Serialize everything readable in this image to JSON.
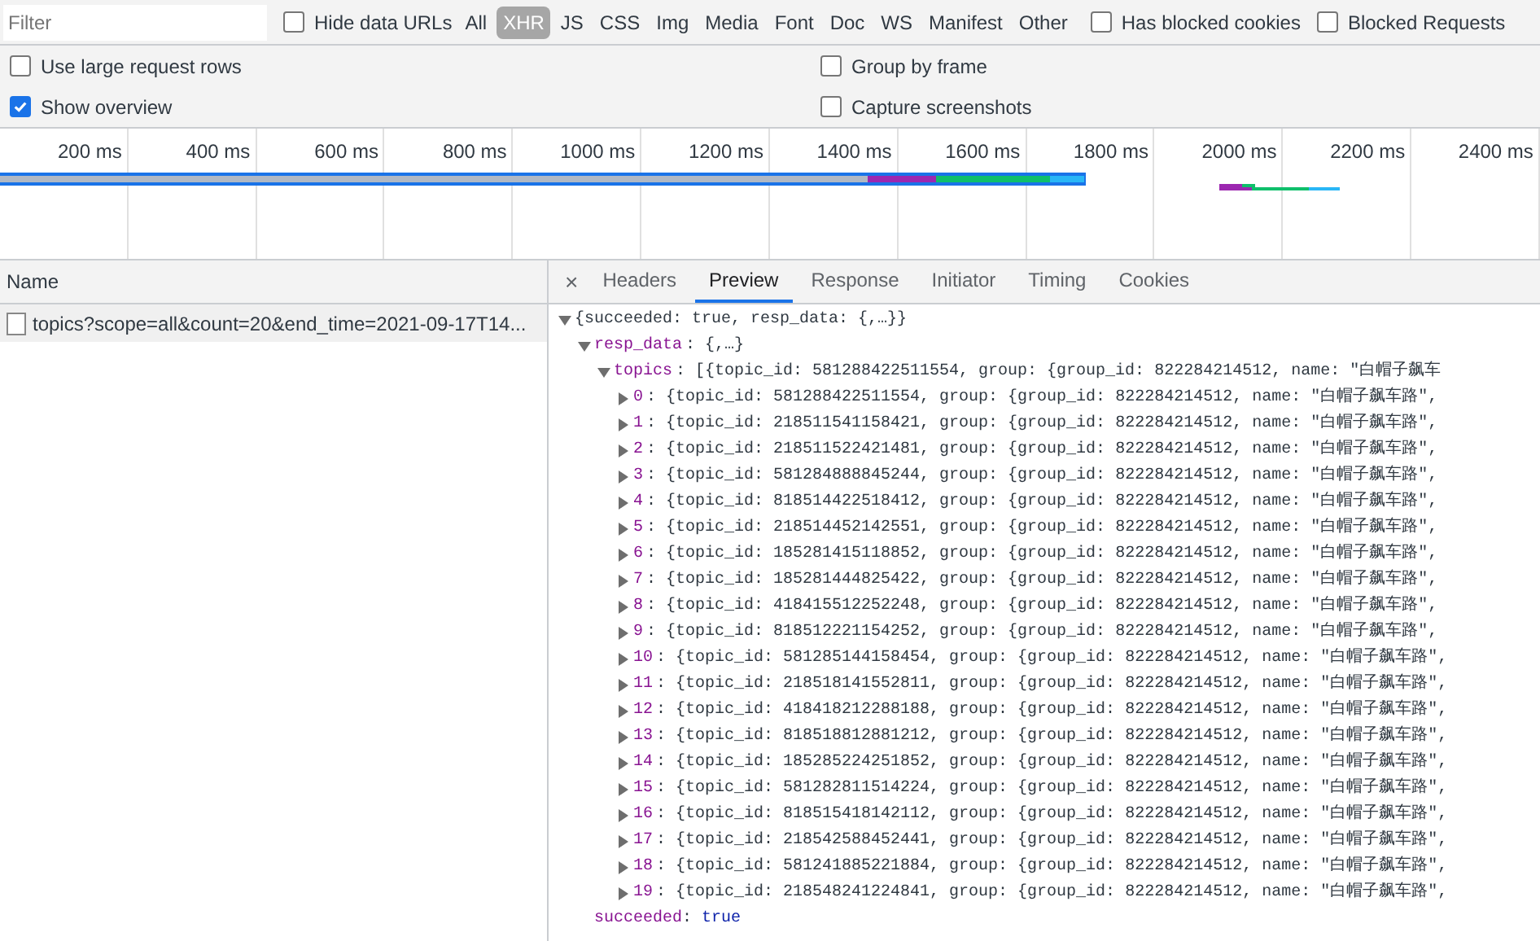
{
  "toolbar": {
    "filter": {
      "placeholder": "Filter"
    },
    "hide_data_urls": {
      "label": "Hide data URLs",
      "checked": false
    },
    "types": [
      {
        "label": "All",
        "selected": false
      },
      {
        "label": "XHR",
        "selected": true
      },
      {
        "label": "JS",
        "selected": false
      },
      {
        "label": "CSS",
        "selected": false
      },
      {
        "label": "Img",
        "selected": false
      },
      {
        "label": "Media",
        "selected": false
      },
      {
        "label": "Font",
        "selected": false
      },
      {
        "label": "Doc",
        "selected": false
      },
      {
        "label": "WS",
        "selected": false
      },
      {
        "label": "Manifest",
        "selected": false
      },
      {
        "label": "Other",
        "selected": false
      }
    ],
    "extra": [
      {
        "label": "Has blocked cookies",
        "checked": false
      },
      {
        "label": "Blocked Requests",
        "checked": false
      }
    ]
  },
  "settings": [
    {
      "label": "Use large request rows",
      "checked": false
    },
    {
      "label": "Group by frame",
      "checked": false
    },
    {
      "label": "Show overview",
      "checked": true
    },
    {
      "label": "Capture screenshots",
      "checked": false
    }
  ],
  "overview": {
    "ticks": [
      "200 ms",
      "400 ms",
      "600 ms",
      "800 ms",
      "1000 ms",
      "1200 ms",
      "1400 ms",
      "1600 ms",
      "1800 ms",
      "2000 ms",
      "2200 ms",
      "2400 ms"
    ]
  },
  "requests": {
    "column": "Name",
    "rows": [
      {
        "name": "topics?scope=all&count=20&end_time=2021-09-17T14...",
        "selected": true
      }
    ]
  },
  "details": {
    "close": "×",
    "tabs": [
      {
        "label": "Headers",
        "selected": false
      },
      {
        "label": "Preview",
        "selected": true
      },
      {
        "label": "Response",
        "selected": false
      },
      {
        "label": "Initiator",
        "selected": false
      },
      {
        "label": "Timing",
        "selected": false
      },
      {
        "label": "Cookies",
        "selected": false
      }
    ],
    "preview": {
      "root": "{succeeded: true, resp_data: {,…}}",
      "resp_key": "resp_data",
      "resp_value": ": {,…}",
      "topics_key": "topics",
      "topics_value": ": [{topic_id: 581288422511554, group: {group_id: 822284214512, name: \"白帽子飙车",
      "items": [
        {
          "key": "0",
          "value": ": {topic_id: 581288422511554, group: {group_id: 822284214512, name: \"白帽子飙车路\","
        },
        {
          "key": "1",
          "value": ": {topic_id: 218511541158421, group: {group_id: 822284214512, name: \"白帽子飙车路\","
        },
        {
          "key": "2",
          "value": ": {topic_id: 218511522421481, group: {group_id: 822284214512, name: \"白帽子飙车路\","
        },
        {
          "key": "3",
          "value": ": {topic_id: 581284888845244, group: {group_id: 822284214512, name: \"白帽子飙车路\","
        },
        {
          "key": "4",
          "value": ": {topic_id: 818514422518412, group: {group_id: 822284214512, name: \"白帽子飙车路\","
        },
        {
          "key": "5",
          "value": ": {topic_id: 218514452142551, group: {group_id: 822284214512, name: \"白帽子飙车路\","
        },
        {
          "key": "6",
          "value": ": {topic_id: 185281415118852, group: {group_id: 822284214512, name: \"白帽子飙车路\","
        },
        {
          "key": "7",
          "value": ": {topic_id: 185281444825422, group: {group_id: 822284214512, name: \"白帽子飙车路\","
        },
        {
          "key": "8",
          "value": ": {topic_id: 418415512252248, group: {group_id: 822284214512, name: \"白帽子飙车路\","
        },
        {
          "key": "9",
          "value": ": {topic_id: 818512221154252, group: {group_id: 822284214512, name: \"白帽子飙车路\","
        },
        {
          "key": "10",
          "value": ": {topic_id: 581285144158454, group: {group_id: 822284214512, name: \"白帽子飙车路\","
        },
        {
          "key": "11",
          "value": ": {topic_id: 218518141552811, group: {group_id: 822284214512, name: \"白帽子飙车路\","
        },
        {
          "key": "12",
          "value": ": {topic_id: 418418212288188, group: {group_id: 822284214512, name: \"白帽子飙车路\","
        },
        {
          "key": "13",
          "value": ": {topic_id: 818518812881212, group: {group_id: 822284214512, name: \"白帽子飙车路\","
        },
        {
          "key": "14",
          "value": ": {topic_id: 185285224251852, group: {group_id: 822284214512, name: \"白帽子飙车路\","
        },
        {
          "key": "15",
          "value": ": {topic_id: 581282811514224, group: {group_id: 822284214512, name: \"白帽子飙车路\","
        },
        {
          "key": "16",
          "value": ": {topic_id: 818515418142112, group: {group_id: 822284214512, name: \"白帽子飙车路\","
        },
        {
          "key": "17",
          "value": ": {topic_id: 218542588452441, group: {group_id: 822284214512, name: \"白帽子飙车路\","
        },
        {
          "key": "18",
          "value": ": {topic_id: 581241885221884, group: {group_id: 822284214512, name: \"白帽子飙车路\","
        },
        {
          "key": "19",
          "value": ": {topic_id: 218548241224841, group: {group_id: 822284214512, name: \"白帽子飙车路\","
        }
      ],
      "succeeded_key": "succeeded",
      "succeeded_sep": ": ",
      "succeeded_value": "true"
    }
  }
}
